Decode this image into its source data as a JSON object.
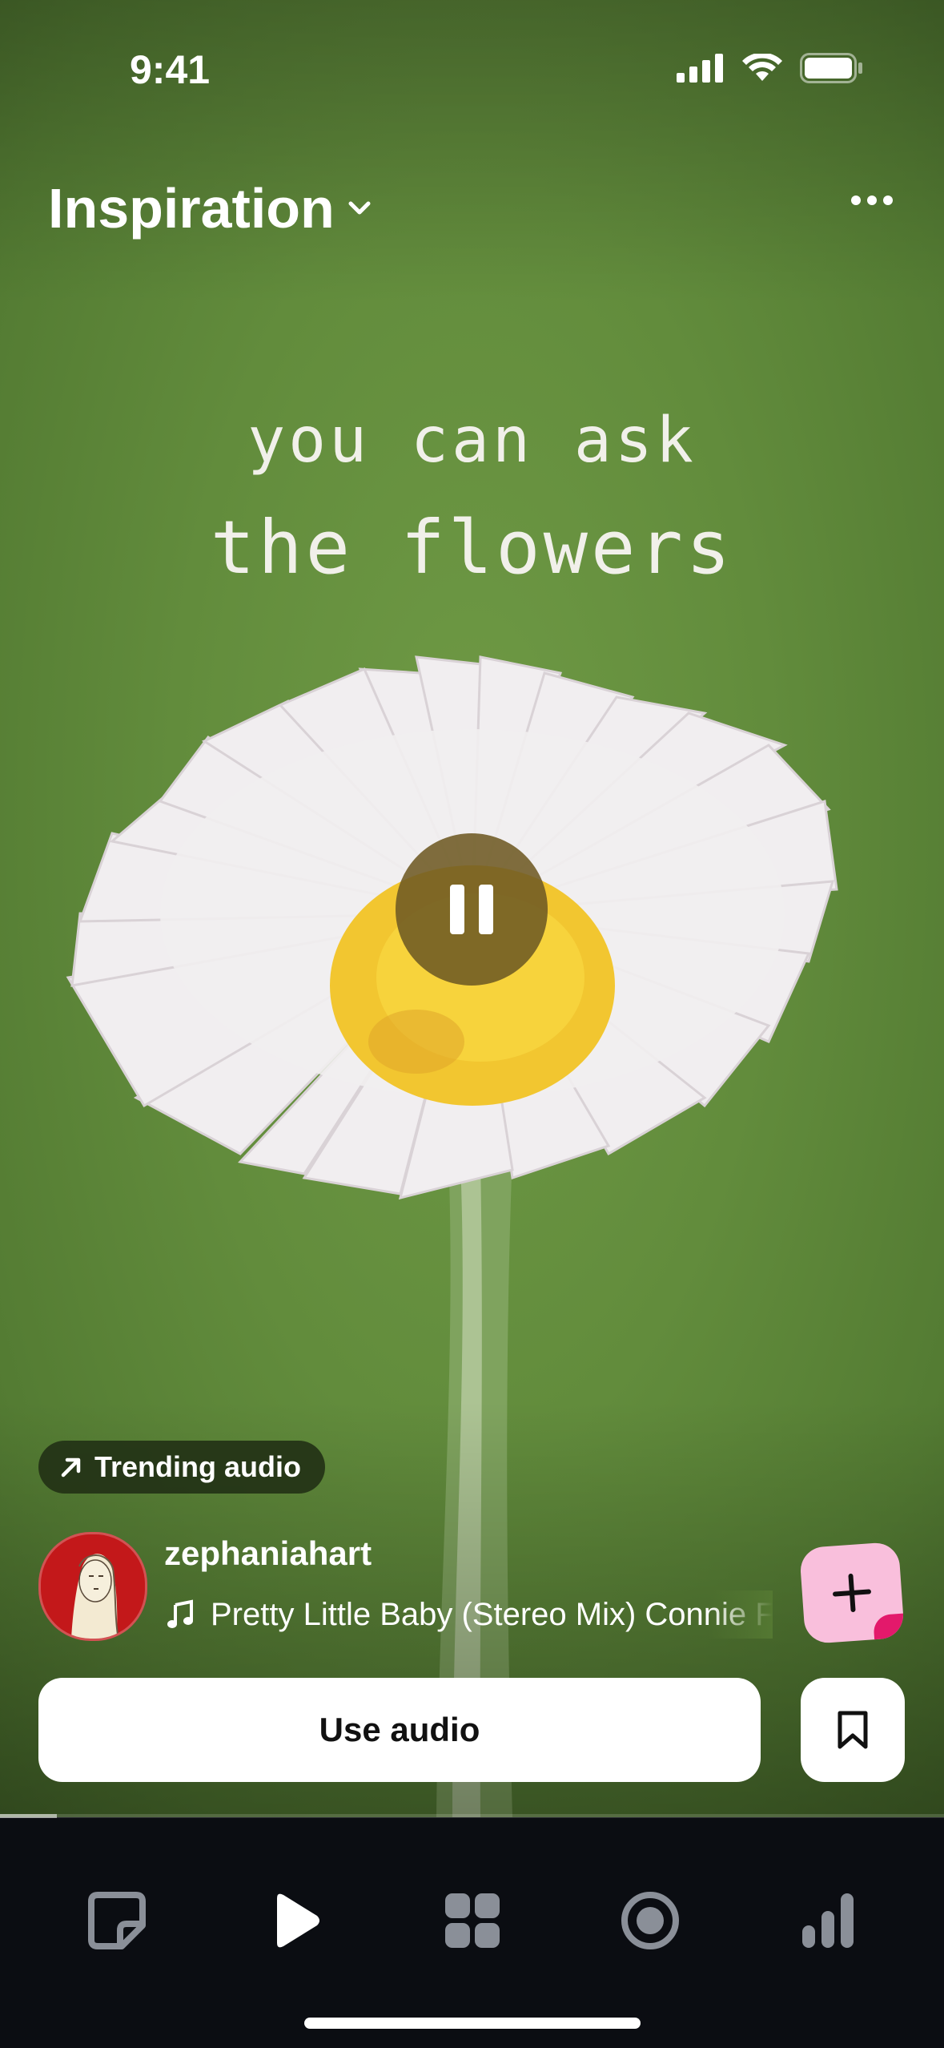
{
  "status_bar": {
    "time": "9:41"
  },
  "header": {
    "title": "Inspiration"
  },
  "video": {
    "caption_line_1": "you can ask",
    "caption_line_2": "the flowers",
    "progress": 0.06
  },
  "trending_chip": {
    "label": "Trending audio"
  },
  "creator": {
    "username": "zephaniahart",
    "track": "Pretty Little Baby (Stereo Mix)   Connie Francis"
  },
  "actions": {
    "use_audio_label": "Use audio"
  },
  "colors": {
    "background_green": "#628c3c",
    "tab_bar": "#0b0d12",
    "create_button": "#f9bfdc",
    "create_accent": "#e3196b",
    "active_tab": "#ffffff",
    "inactive_tab": "#8a8f98"
  },
  "tab_bar": {
    "items": [
      {
        "icon": "notes-icon",
        "active": false
      },
      {
        "icon": "play-icon",
        "active": true
      },
      {
        "icon": "grid-icon",
        "active": false
      },
      {
        "icon": "record-icon",
        "active": false
      },
      {
        "icon": "stats-icon",
        "active": false
      }
    ]
  }
}
